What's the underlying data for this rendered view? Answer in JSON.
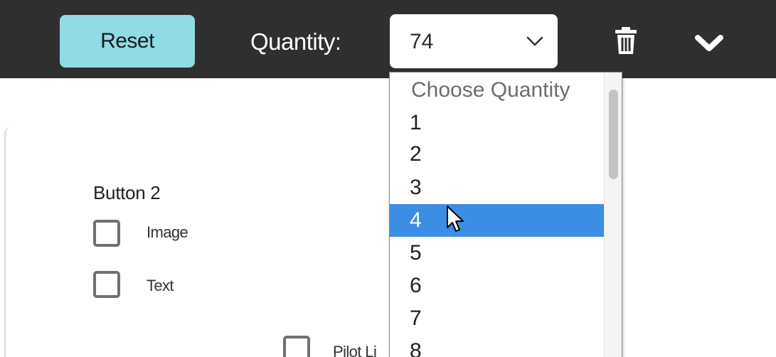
{
  "toolbar": {
    "reset_label": "Reset",
    "quantity_label": "Quantity:",
    "quantity_value": "74"
  },
  "section": {
    "title": "Button 2",
    "options": [
      {
        "label": "Image",
        "checked": false
      },
      {
        "label": "Text",
        "checked": false
      },
      {
        "label": "Pilot Li",
        "checked": false
      }
    ]
  },
  "dropdown": {
    "placeholder": "Choose Quantity",
    "options": [
      "1",
      "2",
      "3",
      "4",
      "5",
      "6",
      "7",
      "8"
    ],
    "highlighted": "4",
    "highlight_color": "#3b8ee3"
  },
  "colors": {
    "toolbar_bg": "#2f2f2f",
    "reset_bg": "#8fdbe6"
  },
  "icons": [
    "chevron-down-icon",
    "trash-icon",
    "expand-chevron-icon",
    "cursor-icon"
  ]
}
